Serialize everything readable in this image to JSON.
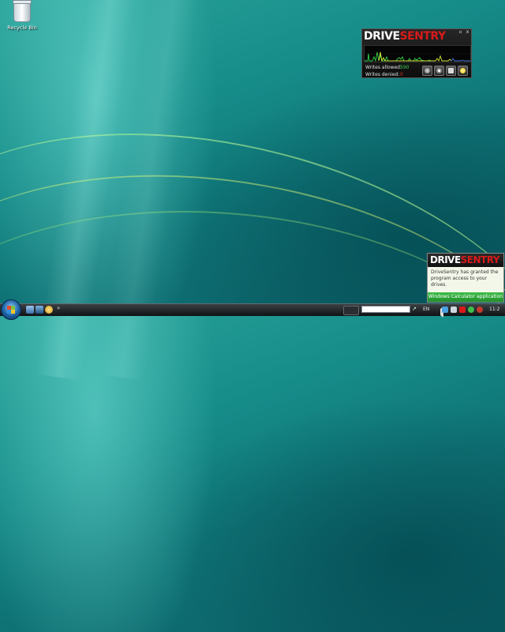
{
  "desktop": {
    "icons": [
      {
        "label": "Recycle Bin",
        "icon": "recycle-bin-icon"
      }
    ]
  },
  "gadget": {
    "brand_white": "DRIVE",
    "brand_red": "SENTRY",
    "btn_min": "▫",
    "btn_close": "x",
    "writes_allowed_label": "Writes allowed:",
    "writes_allowed_value": "590",
    "writes_denied_label": "Writes denied:",
    "writes_denied_value": "0",
    "buttons": [
      "monitor-icon",
      "settings-gear-icon",
      "drive-icon",
      "lightbulb-icon"
    ],
    "colors": {
      "brand_red": "#d81a1a",
      "allowed": "#39d34a",
      "denied": "#e23a2a"
    }
  },
  "notification": {
    "brand_white": "DRIVE",
    "brand_red": "SENTRY",
    "message": "DriveSentry has granted the program access to your drives.",
    "application": "Windows Calculator application file"
  },
  "taskbar": {
    "quick_launch": [
      "show-desktop-icon",
      "switch-windows-icon",
      "ie-icon"
    ],
    "overflow": "»",
    "search_go": "↗",
    "language": "EN",
    "tray": [
      "tray-arrow-icon",
      "network-icon",
      "volume-icon",
      "drivesentry-tray-icon",
      "security-icon"
    ],
    "clock": "11:2"
  }
}
